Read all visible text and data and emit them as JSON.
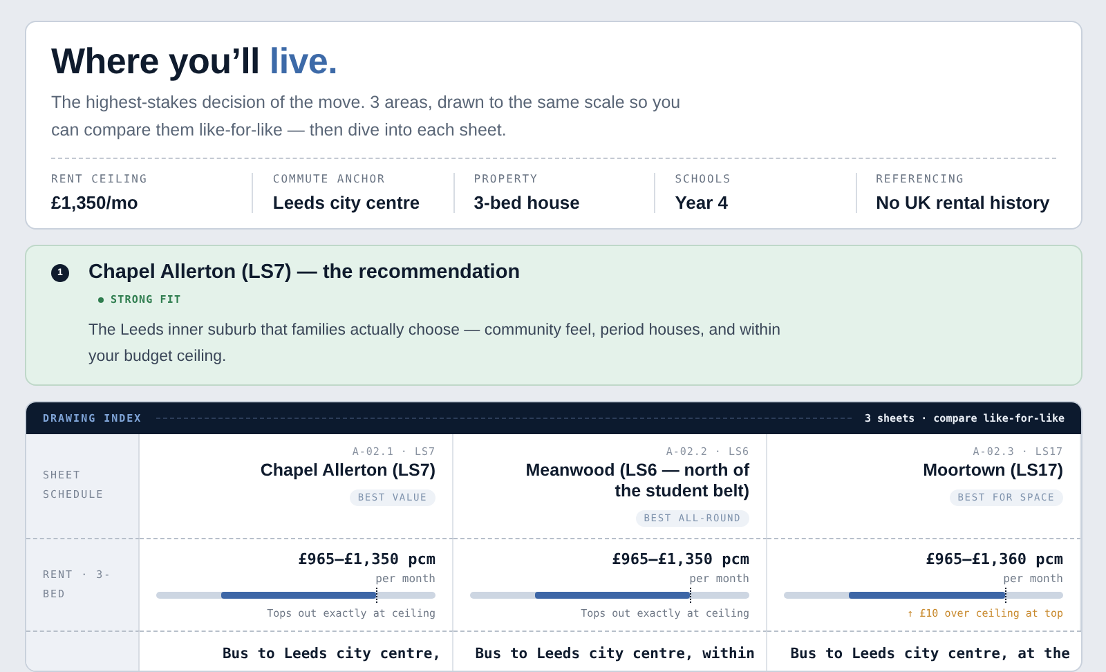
{
  "header": {
    "title": "Where you’ll",
    "title_accent": "live.",
    "intro": "The highest-stakes decision of the move. 3 areas, drawn to the same scale so you can compare them like-for-like — then dive into each sheet.",
    "facts": [
      {
        "label": "RENT CEILING",
        "value": "£1,350/mo"
      },
      {
        "label": "COMMUTE ANCHOR",
        "value": "Leeds city centre"
      },
      {
        "label": "PROPERTY",
        "value": "3-bed house"
      },
      {
        "label": "SCHOOLS",
        "value": "Year 4"
      },
      {
        "label": "REFERENCING",
        "value": "No UK rental history"
      }
    ]
  },
  "recommendation": {
    "number": "1",
    "title": "Chapel Allerton (LS7) — the recommendation",
    "badge": "STRONG FIT",
    "text": "The Leeds inner suburb that families actually choose — community feel, period houses, and within your budget ceiling."
  },
  "drawing_index": {
    "title": "DRAWING INDEX",
    "summary": "3 sheets · compare like-for-like",
    "row_labels": [
      "SHEET SCHEDULE",
      "RENT · 3-BED"
    ],
    "sheets": [
      {
        "code": "A-02.1 · LS7",
        "name": "Chapel Allerton (LS7)",
        "tag": "BEST VALUE",
        "rent": "£965–£1,350 pcm",
        "period": "per month",
        "level": 0.72,
        "note": "Tops out exactly at ceiling",
        "over": false,
        "commute": "Bus to Leeds city centre,"
      },
      {
        "code": "A-02.2 · LS6",
        "name": "Meanwood (LS6 — north of the student belt)",
        "tag": "BEST ALL-ROUND",
        "rent": "£965–£1,350 pcm",
        "period": "per month",
        "level": 0.72,
        "note": "Tops out exactly at ceiling",
        "over": false,
        "commute": "Bus to Leeds city centre, within"
      },
      {
        "code": "A-02.3 · LS17",
        "name": "Moortown (LS17)",
        "tag": "BEST FOR SPACE",
        "rent": "£965–£1,360 pcm",
        "period": "per month",
        "level": 0.73,
        "note": "↑ £10 over ceiling at top",
        "over": true,
        "commute": "Bus to Leeds city centre, at the"
      }
    ]
  }
}
